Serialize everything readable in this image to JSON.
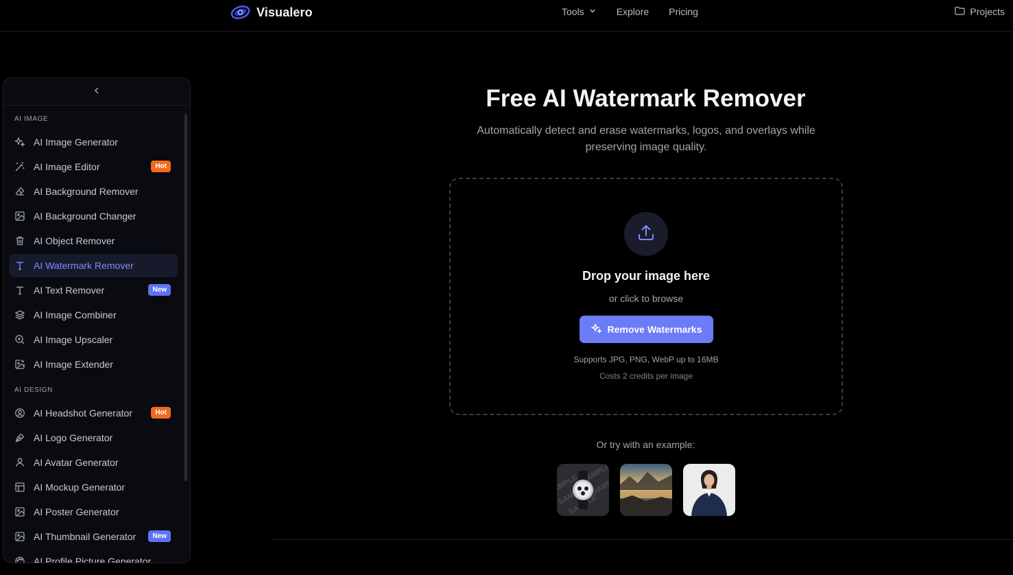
{
  "header": {
    "brand": "Visualero",
    "nav": [
      {
        "label": "Tools",
        "icon": "chevron-down-icon"
      },
      {
        "label": "Explore"
      },
      {
        "label": "Pricing"
      }
    ],
    "projects_label": "Projects"
  },
  "sidebar": {
    "sections": [
      {
        "title": "AI IMAGE",
        "items": [
          {
            "label": "AI Image Generator",
            "icon": "sparkles-icon"
          },
          {
            "label": "AI Image Editor",
            "icon": "magic-wand-icon",
            "badge": "Hot"
          },
          {
            "label": "AI Background Remover",
            "icon": "eraser-icon"
          },
          {
            "label": "AI Background Changer",
            "icon": "image-icon"
          },
          {
            "label": "AI Object Remover",
            "icon": "trash-icon"
          },
          {
            "label": "AI Watermark Remover",
            "icon": "text-icon",
            "active": true
          },
          {
            "label": "AI Text Remover",
            "icon": "text-icon",
            "badge": "New"
          },
          {
            "label": "AI Image Combiner",
            "icon": "layers-icon"
          },
          {
            "label": "AI Image Upscaler",
            "icon": "zoom-in-icon"
          },
          {
            "label": "AI Image Extender",
            "icon": "image-plus-icon"
          }
        ]
      },
      {
        "title": "AI DESIGN",
        "items": [
          {
            "label": "AI Headshot Generator",
            "icon": "user-circle-icon",
            "badge": "Hot"
          },
          {
            "label": "AI Logo Generator",
            "icon": "pen-nib-icon"
          },
          {
            "label": "AI Avatar Generator",
            "icon": "user-icon"
          },
          {
            "label": "AI Mockup Generator",
            "icon": "layout-icon"
          },
          {
            "label": "AI Poster Generator",
            "icon": "image-icon"
          },
          {
            "label": "AI Thumbnail Generator",
            "icon": "image-icon",
            "badge": "New"
          },
          {
            "label": "AI Profile Picture Generator",
            "icon": "palette-icon"
          }
        ]
      }
    ]
  },
  "main": {
    "title": "Free AI Watermark Remover",
    "subtitle": "Automatically detect and erase watermarks, logos, and overlays while preserving image quality.",
    "dropzone": {
      "title": "Drop your image here",
      "subtitle": "or click to browse",
      "button": "Remove Watermarks",
      "supports": "Supports JPG, PNG, WebP up to 16MB",
      "costs": "Costs 2 credits per image"
    },
    "examples_label": "Or try with an example:",
    "examples": [
      {
        "name": "watch-sample-thumbnail",
        "overlay_text": "SAMPLE"
      },
      {
        "name": "lake-sunset-thumbnail"
      },
      {
        "name": "businesswoman-portrait-thumbnail"
      }
    ]
  },
  "colors": {
    "accent": "#6a7cf6",
    "active_text": "#7d8cff",
    "hot_badge": "#f26a1b",
    "new_badge": "#5f73f2",
    "background": "#000000"
  }
}
